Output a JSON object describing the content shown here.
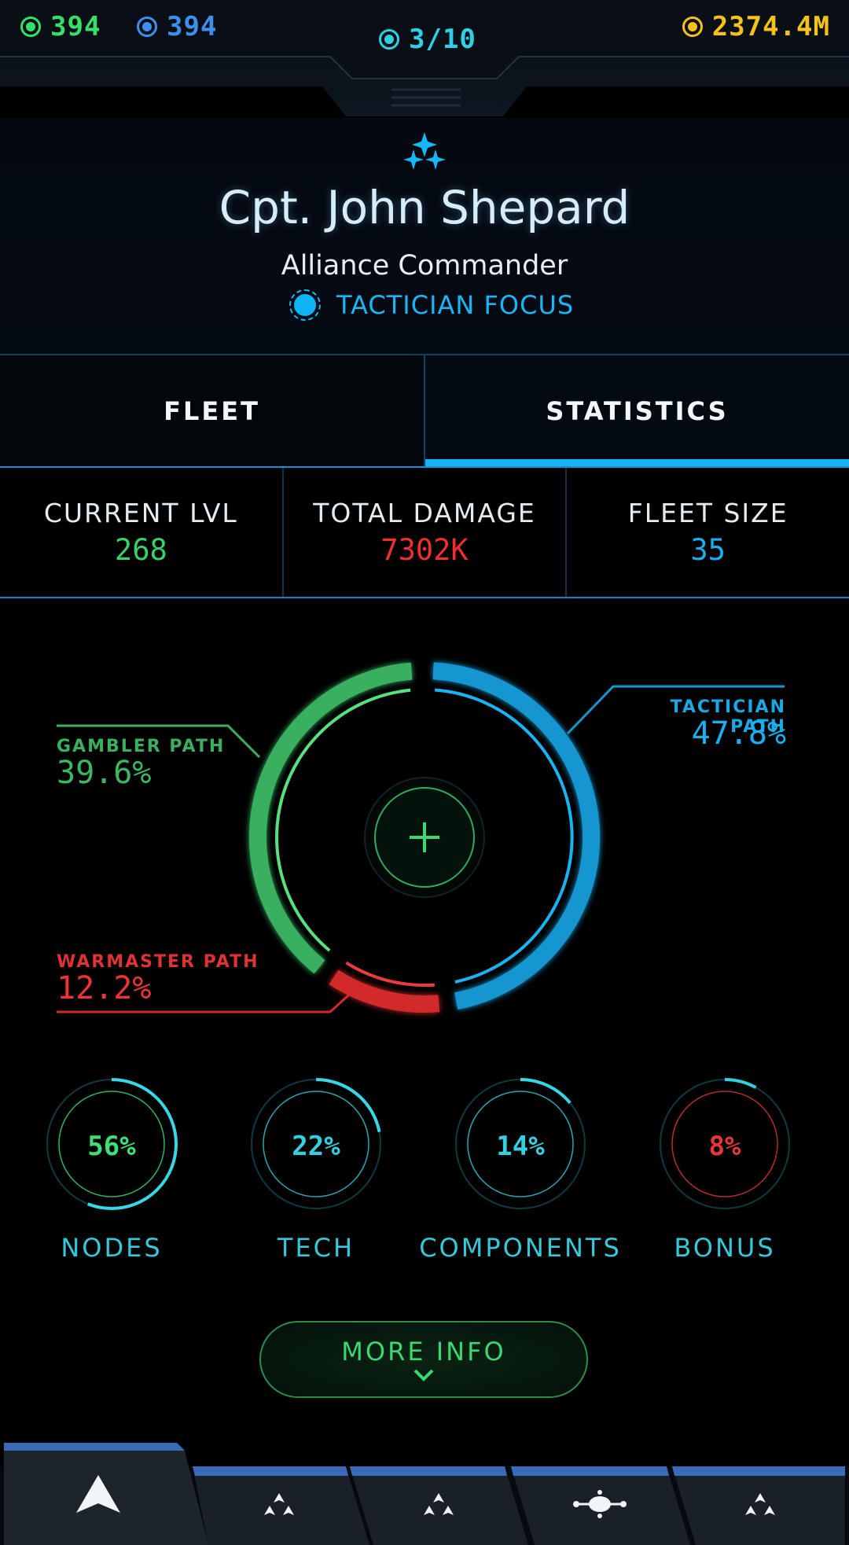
{
  "resources": {
    "green": "394",
    "blue": "394",
    "wave": "3/10",
    "gold": "2374.4M"
  },
  "captain": {
    "name": "Cpt. John Shepard",
    "title": "Alliance Commander",
    "focus": "TACTICIAN FOCUS"
  },
  "tabs": [
    {
      "label": "FLEET",
      "active": false
    },
    {
      "label": "STATISTICS",
      "active": true
    }
  ],
  "stats": [
    {
      "label": "CURRENT LVL",
      "value": "268"
    },
    {
      "label": "TOTAL DAMAGE",
      "value": "7302K"
    },
    {
      "label": "FLEET SIZE",
      "value": "35"
    }
  ],
  "paths": [
    {
      "label": "TACTICIAN PATH",
      "value": "47.8%",
      "fraction": 0.478,
      "color": "#1596d0"
    },
    {
      "label": "WARMASTER PATH",
      "value": "12.2%",
      "fraction": 0.122,
      "color": "#d22b2b"
    },
    {
      "label": "GAMBLER PATH",
      "value": "39.6%",
      "fraction": 0.396,
      "color": "#38b060"
    }
  ],
  "meters": [
    {
      "label": "NODES",
      "value": "56%",
      "fraction": 0.56,
      "color": "#3fe07a"
    },
    {
      "label": "TECH",
      "value": "22%",
      "fraction": 0.22,
      "color": "#35d0e0"
    },
    {
      "label": "COMPONENTS",
      "value": "14%",
      "fraction": 0.14,
      "color": "#35d0e0"
    },
    {
      "label": "BONUS",
      "value": "8%",
      "fraction": 0.08,
      "color": "#e43838"
    }
  ],
  "more_info": "MORE INFO",
  "colors": {
    "accent_blue": "#14b4f5",
    "green": "#35d46a",
    "red": "#ef2e2e",
    "gold": "#f5c21b"
  },
  "nav_icons": [
    "ship-arrow-icon",
    "fleet-formation-icon",
    "fleet-formation-icon",
    "galaxy-map-icon",
    "fleet-formation-icon"
  ]
}
